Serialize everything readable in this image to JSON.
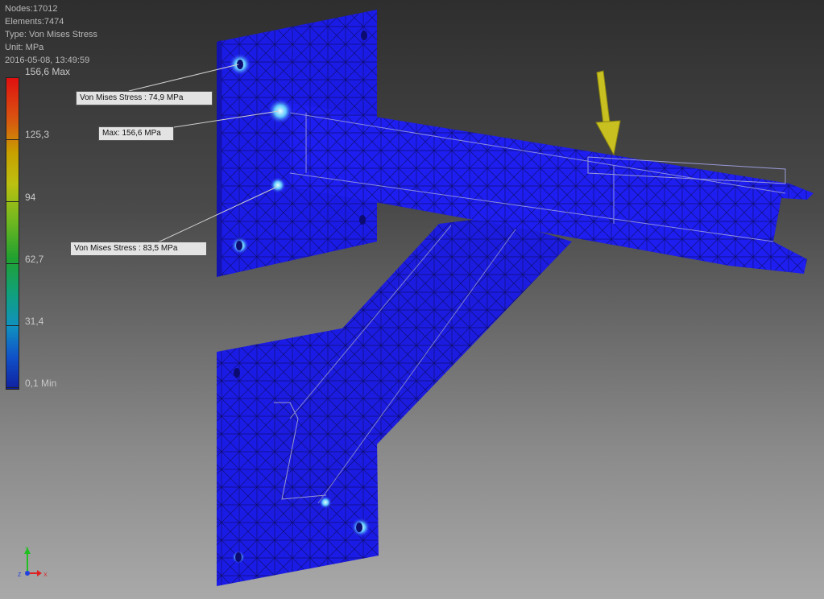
{
  "info": {
    "nodes": "Nodes:17012",
    "elements": "Elements:7474",
    "type": "Type: Von Mises Stress",
    "unit": "Unit: MPa",
    "timestamp": "2016-05-08, 13:49:59"
  },
  "legend": {
    "max_label": "156,6 Max",
    "ticks": [
      "125,3",
      "94",
      "62,7",
      "31,4"
    ],
    "min_label": "0,1 Min"
  },
  "callouts": {
    "c1": "Von Mises Stress : 74,9 MPa",
    "c2": "Max: 156,6 MPa",
    "c3": "Von Mises Stress : 83,5 MPa"
  },
  "triad": {
    "x": "X",
    "y": "Y",
    "z": "Z"
  },
  "colors": {
    "model": "#1a1ae8",
    "mesh": "#0a0a40",
    "load_arrow": "#c8c020",
    "highlight": "#9fe0ff"
  }
}
